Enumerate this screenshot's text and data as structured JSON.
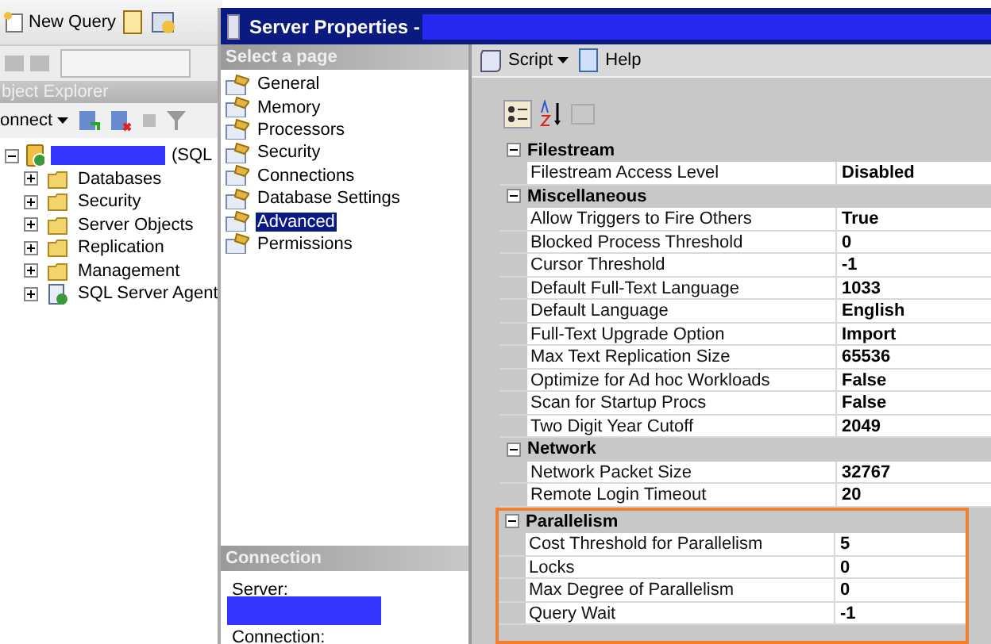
{
  "main_toolbar": {
    "buttons": [
      {
        "label": "New Query"
      }
    ]
  },
  "object_explorer": {
    "title": "bject Explorer",
    "connect_label": "onnect",
    "tree": [
      {
        "label": "(SQL",
        "kind": "server",
        "expanded": true,
        "children": [
          {
            "label": "Databases",
            "kind": "folder",
            "expanded": false
          },
          {
            "label": "Security",
            "kind": "folder",
            "expanded": false
          },
          {
            "label": "Server Objects",
            "kind": "folder",
            "expanded": false
          },
          {
            "label": "Replication",
            "kind": "folder",
            "expanded": false
          },
          {
            "label": "Management",
            "kind": "folder",
            "expanded": false
          },
          {
            "label": "SQL Server Agent",
            "kind": "agent",
            "expanded": false
          }
        ]
      }
    ]
  },
  "dialog": {
    "title": "Server Properties -",
    "page_list_header": "Select a page",
    "pages": [
      {
        "label": "General",
        "selected": false
      },
      {
        "label": "Memory",
        "selected": false
      },
      {
        "label": "Processors",
        "selected": false
      },
      {
        "label": "Security",
        "selected": false
      },
      {
        "label": "Connections",
        "selected": false
      },
      {
        "label": "Database Settings",
        "selected": false
      },
      {
        "label": "Advanced",
        "selected": true
      },
      {
        "label": "Permissions",
        "selected": false
      }
    ],
    "connection": {
      "header": "Connection",
      "labels": [
        "Server:",
        "Connection:"
      ]
    },
    "toolbar": [
      {
        "label": "Script",
        "dropdown": true
      },
      {
        "label": "Help",
        "dropdown": false
      }
    ],
    "grid": {
      "categories": [
        {
          "name": "Filestream",
          "expanded": true,
          "highlighted": false,
          "properties": [
            {
              "name": "Filestream Access Level",
              "value": "Disabled"
            }
          ]
        },
        {
          "name": "Miscellaneous",
          "expanded": true,
          "highlighted": false,
          "properties": [
            {
              "name": "Allow Triggers to Fire Others",
              "value": "True"
            },
            {
              "name": "Blocked Process Threshold",
              "value": "0"
            },
            {
              "name": "Cursor Threshold",
              "value": "-1"
            },
            {
              "name": "Default Full-Text Language",
              "value": "1033"
            },
            {
              "name": "Default Language",
              "value": "English"
            },
            {
              "name": "Full-Text Upgrade Option",
              "value": "Import"
            },
            {
              "name": "Max Text Replication Size",
              "value": "65536"
            },
            {
              "name": "Optimize for Ad hoc Workloads",
              "value": "False"
            },
            {
              "name": "Scan for Startup Procs",
              "value": "False"
            },
            {
              "name": "Two Digit Year Cutoff",
              "value": "2049"
            }
          ]
        },
        {
          "name": "Network",
          "expanded": true,
          "highlighted": false,
          "properties": [
            {
              "name": "Network Packet Size",
              "value": "32767"
            },
            {
              "name": "Remote Login Timeout",
              "value": "20"
            }
          ]
        },
        {
          "name": "Parallelism",
          "expanded": true,
          "highlighted": true,
          "properties": [
            {
              "name": "Cost Threshold for Parallelism",
              "value": "5"
            },
            {
              "name": "Locks",
              "value": "0"
            },
            {
              "name": "Max Degree of Parallelism",
              "value": "0"
            },
            {
              "name": "Query Wait",
              "value": "-1"
            }
          ]
        }
      ]
    }
  }
}
